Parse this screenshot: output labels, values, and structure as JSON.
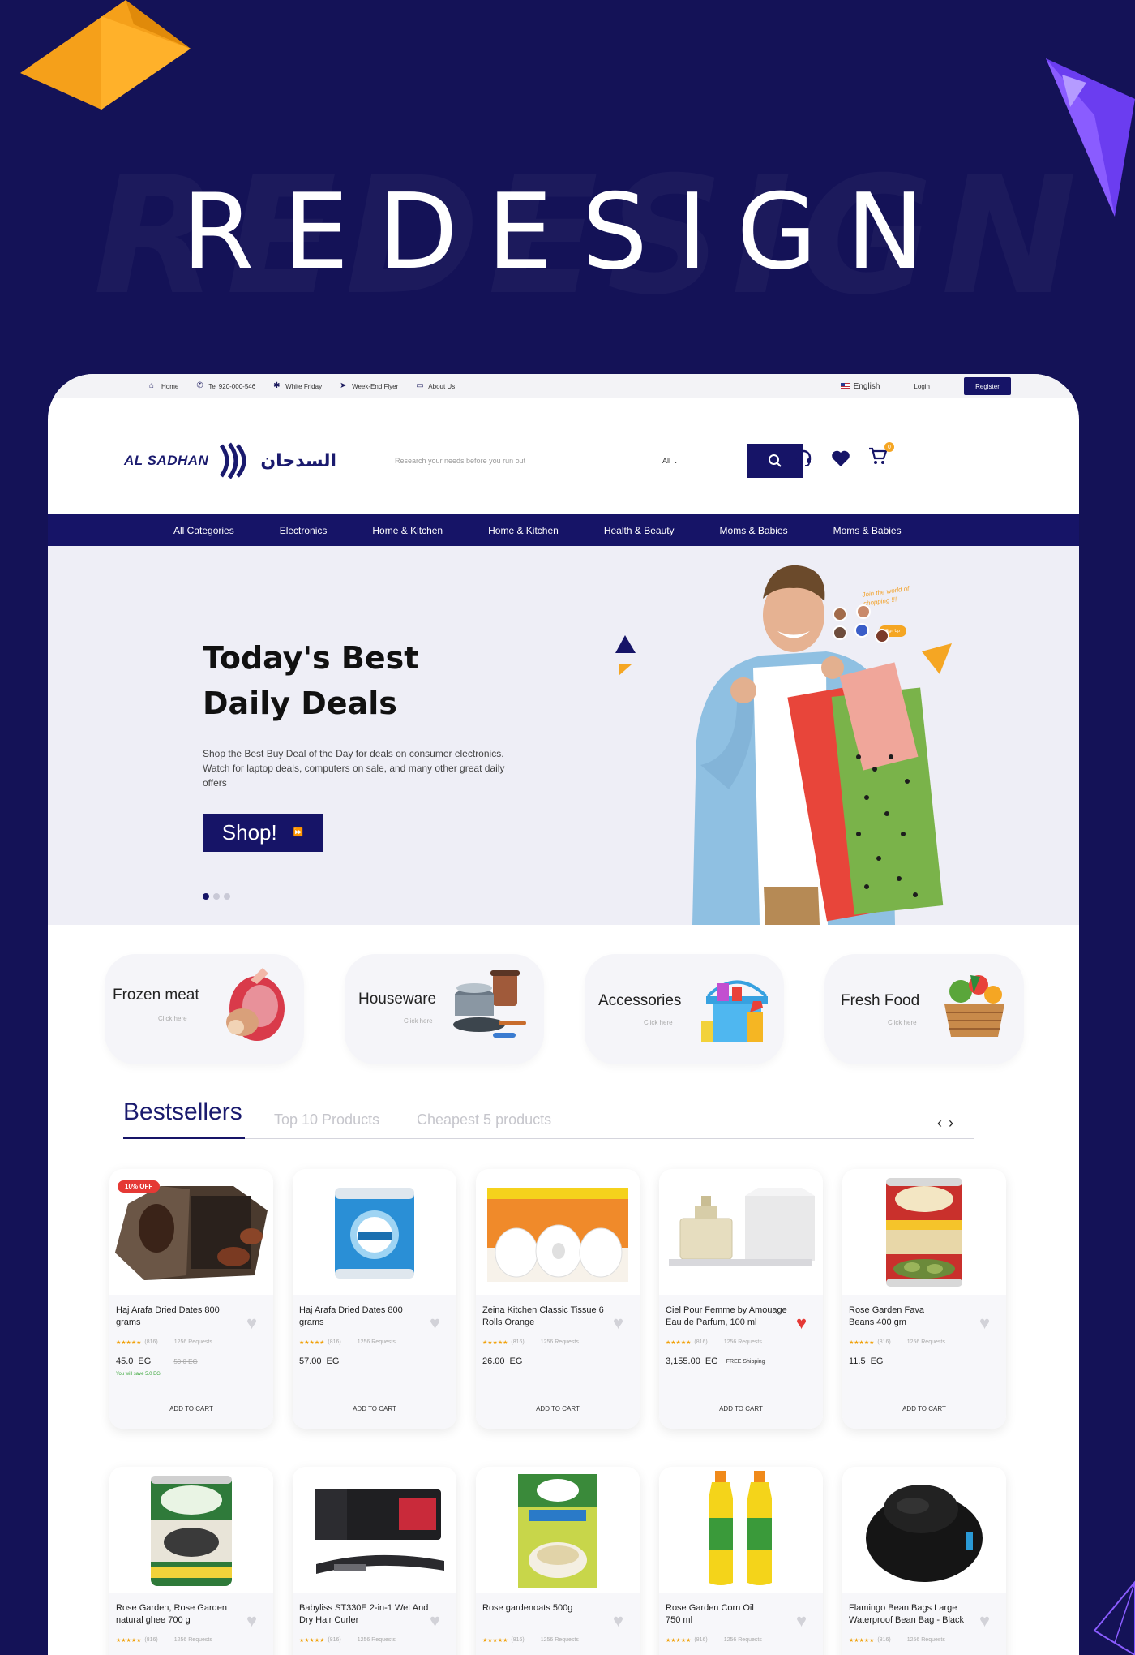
{
  "banner": {
    "title": "REDESIGN",
    "ghost": "REDESIGN"
  },
  "topbar": {
    "items": [
      {
        "icon": "home-icon",
        "label": "Home"
      },
      {
        "icon": "phone-icon",
        "label": "Tel 920-000-546"
      },
      {
        "icon": "tag-icon",
        "label": "White Friday"
      },
      {
        "icon": "send-icon",
        "label": "Week-End Flyer"
      },
      {
        "icon": "info-icon",
        "label": "About Us"
      }
    ],
    "language": "English",
    "login": "Login",
    "register": "Register"
  },
  "header": {
    "logo_en": "AL SADHAN",
    "logo_ar": "السدحان",
    "search_placeholder": "Research your needs before you run out",
    "category_select": "All",
    "cart_count": "0"
  },
  "nav": [
    "All Categories",
    "Electronics",
    "Home & Kitchen",
    "Home & Kitchen",
    "Health & Beauty",
    "Moms & Babies",
    "Moms & Babies"
  ],
  "hero": {
    "title": "Today's Best Daily Deals",
    "description": "Shop the Best Buy Deal of the Day for deals on consumer electronics. Watch for laptop deals, computers on sale, and many other great daily offers",
    "cta": "Shop!",
    "join_text": "Join the world of shopping !!!",
    "signup": "Sign Up",
    "slides": 3,
    "active_slide": 1
  },
  "categories": [
    {
      "label": "Frozen meat",
      "sub": "Click here",
      "icon": "meat-icon"
    },
    {
      "label": "Houseware",
      "sub": "Click here",
      "icon": "cookware-icon"
    },
    {
      "label": "Accessories",
      "sub": "Click here",
      "icon": "cleaning-supplies-icon"
    },
    {
      "label": "Fresh Food",
      "sub": "Click here",
      "icon": "vegetable-basket-icon"
    }
  ],
  "tabs": {
    "active": "Bestsellers",
    "others": [
      "Top 10 Products",
      "Cheapest 5 products"
    ]
  },
  "products_row1": [
    {
      "name": "Haj Arafa Dried Dates 800 grams",
      "rating_count": "(816)",
      "requests": "1256 Requests",
      "price": "45.0",
      "currency": "EG",
      "old_price": "50.0   EG",
      "save": "You will save 5.0 EG",
      "badge": "10% OFF",
      "liked": false,
      "add": "ADD TO CART",
      "image": "dates-box-image"
    },
    {
      "name": "Haj Arafa Dried Dates 800 grams",
      "rating_count": "(816)",
      "requests": "1256 Requests",
      "price": "57.00",
      "currency": "EG",
      "liked": false,
      "add": "ADD TO CART",
      "image": "dates-canister-image"
    },
    {
      "name": "Zeina Kitchen Classic Tissue 6 Rolls Orange",
      "rating_count": "(816)",
      "requests": "1256 Requests",
      "price": "26.00",
      "currency": "EG",
      "liked": false,
      "add": "ADD TO CART",
      "image": "tissue-rolls-image"
    },
    {
      "name": "Ciel Pour Femme by Amouage Eau de Parfum, 100 ml",
      "rating_count": "(816)",
      "requests": "1256 Requests",
      "price": "3,155.00",
      "currency": "EG",
      "shipping": "FREE Shipping",
      "liked": true,
      "add": "ADD TO CART",
      "image": "perfume-image"
    },
    {
      "name": "Rose Garden Fava Beans 400 gm",
      "rating_count": "(816)",
      "requests": "1256 Requests",
      "price": "11.5",
      "currency": "EG",
      "liked": false,
      "add": "ADD TO CART",
      "image": "fava-beans-can-image"
    }
  ],
  "products_row2": [
    {
      "name": "Rose Garden, Rose Garden natural ghee 700 g",
      "rating_count": "(816)",
      "requests": "1256 Requests",
      "liked": false,
      "image": "ghee-can-image"
    },
    {
      "name": "Babyliss ST330E 2-in-1 Wet And Dry Hair Curler",
      "rating_count": "(816)",
      "requests": "1256 Requests",
      "liked": false,
      "image": "hair-straightener-image"
    },
    {
      "name": "Rose gardenoats 500g",
      "rating_count": "(816)",
      "requests": "1256 Requests",
      "liked": false,
      "image": "oats-box-image"
    },
    {
      "name": "Rose Garden Corn Oil 750 ml",
      "rating_count": "(816)",
      "requests": "1256 Requests",
      "liked": false,
      "image": "corn-oil-image"
    },
    {
      "name": "Flamingo Bean Bags Large Waterproof Bean Bag - Black",
      "rating_count": "(816)",
      "requests": "1256 Requests",
      "liked": false,
      "image": "bean-bag-image"
    }
  ],
  "colors": {
    "navy": "#161467",
    "background": "#141257",
    "accent": "#f5a623",
    "sale": "#e53935"
  }
}
